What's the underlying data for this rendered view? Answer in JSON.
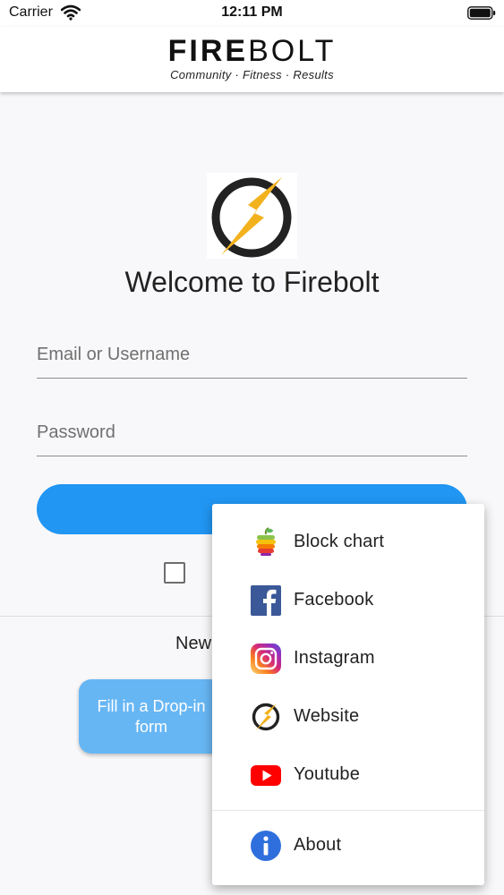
{
  "status_bar": {
    "carrier": "Carrier",
    "time": "12:11 PM"
  },
  "header": {
    "logo_part1": "FIRE",
    "logo_part2": "BOLT",
    "tagline": "Community · Fitness · Results"
  },
  "login": {
    "title": "Welcome to Firebolt",
    "email_placeholder": "Email or Username",
    "password_placeholder": "Password",
    "sign_in_label": "",
    "new_member_text": "New",
    "dropin_label": "Fill in a Drop-in form"
  },
  "menu": {
    "items": [
      {
        "label": "Block chart",
        "icon": "block-chart-icon"
      },
      {
        "label": "Facebook",
        "icon": "facebook-icon"
      },
      {
        "label": "Instagram",
        "icon": "instagram-icon"
      },
      {
        "label": "Website",
        "icon": "website-icon"
      },
      {
        "label": "Youtube",
        "icon": "youtube-icon"
      },
      {
        "label": "About",
        "icon": "info-icon"
      }
    ]
  },
  "colors": {
    "primary": "#2196f3",
    "dropin_button": "#67b6f4",
    "lightning": "#f2b21e",
    "facebook": "#3b5998",
    "youtube": "#ff0000",
    "info": "#2f6fdd"
  }
}
